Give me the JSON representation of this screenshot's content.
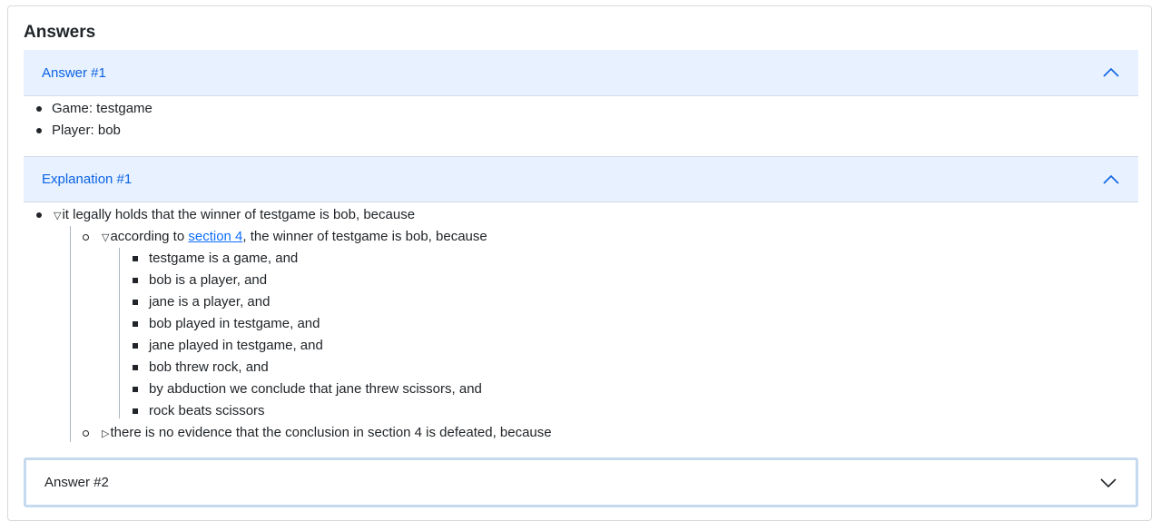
{
  "card": {
    "title": "Answers"
  },
  "answer1": {
    "header": "Answer #1",
    "items": [
      "Game: testgame",
      "Player: bob"
    ]
  },
  "explanation1": {
    "header": "Explanation #1",
    "root": "it legally holds that the winner of testgame is bob, because",
    "child1": {
      "prefix": "according to ",
      "link": "section 4",
      "suffix": ", the winner of testgame is bob, because",
      "items": [
        "testgame is a game, and",
        "bob is a player, and",
        "jane is a player, and",
        "bob played in testgame, and",
        "jane played in testgame, and",
        "bob threw rock, and",
        "by abduction we conclude that jane threw scissors, and",
        "rock beats scissors"
      ]
    },
    "child2": "there is no evidence that the conclusion in section 4 is defeated, because"
  },
  "answer2": {
    "header": "Answer #2"
  },
  "icons": {
    "expanded": "chevron-up-icon",
    "collapsed": "chevron-down-icon",
    "tree_open": "triangle-down-icon",
    "tree_closed": "triangle-right-icon"
  },
  "colors": {
    "accent": "#0c63e4",
    "header_bg": "#e7f1ff",
    "link": "#0d6efd"
  }
}
